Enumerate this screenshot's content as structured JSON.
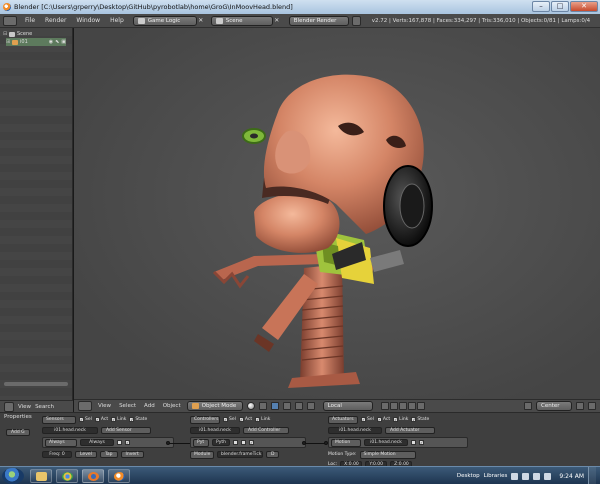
{
  "window": {
    "title": "Blender [C:\\Users\\grperry\\Desktop\\GitHub\\pyrobotlab\\home\\GroG\\InMoovHead.blend]",
    "minimize": "–",
    "maximize": "□",
    "close": "✕"
  },
  "info_header": {
    "menus": [
      "File",
      "Render",
      "Window",
      "Help"
    ],
    "screen_layout": "Game Logic",
    "scene": "Scene",
    "render_engine": "Blender Render",
    "stats": "v2.72 | Verts:167,878 | Faces:334,297 | Tris:336,010 | Objects:0/81 | Lamps:0/4"
  },
  "outliner": {
    "scene_label": "Scene",
    "object_label": "i01",
    "footer": {
      "view": "View",
      "search": "Search"
    }
  },
  "view3d_header": {
    "menus": [
      "View",
      "Select",
      "Add",
      "Object"
    ],
    "mode": "Object Mode",
    "pivot": "Local",
    "snap_target": "Center"
  },
  "logic": {
    "properties_label": "Properties",
    "add_game_property": "Add G",
    "sensors": {
      "title": "Sensors",
      "filters": [
        "Sel",
        "Act",
        "Link",
        "State"
      ],
      "object": "i01.head.neck",
      "add": "Add Sensor",
      "type": "Always",
      "name": "Always",
      "freq_label": "Freq:",
      "freq_value": "0",
      "level": "Level",
      "tap": "Tap",
      "invert": "Invert"
    },
    "controllers": {
      "title": "Controllers",
      "filters": [
        "Sel",
        "Act",
        "Link"
      ],
      "object": "i01.head.neck",
      "add": "Add Controller",
      "type": "Pyt",
      "name": "Pyth",
      "mode": "Module",
      "module": "blender.frameTick",
      "d_label": "D"
    },
    "actuators": {
      "title": "Actuators",
      "filters": [
        "Sel",
        "Act",
        "Link",
        "State"
      ],
      "object": "i01.head.neck",
      "add": "Add Actuator",
      "type": "Motion",
      "name": "i01.head.neck",
      "motion_type_label": "Motion Type:",
      "motion_type": "Simple Motion",
      "loc_label": "Loc:",
      "loc_values": [
        "X:0.00",
        "Y:0.00",
        "Z:0.00"
      ]
    }
  },
  "taskbar": {
    "desktop_label": "Desktop",
    "libraries_label": "Libraries",
    "time": "9:24 AM"
  },
  "colors": {
    "viewport_bg": "#4d4d4d",
    "head_skin": "#d98a6c",
    "selection_green": "#9fc33d",
    "taskbar": "#2a4664"
  },
  "icons": [
    "blender-logo-icon",
    "scene-icon",
    "mesh-icon",
    "eye-icon",
    "cursor-icon",
    "camera-icon",
    "start-orb-icon",
    "explorer-icon",
    "chrome-icon",
    "firefox-icon",
    "blender-taskbar-icon"
  ]
}
